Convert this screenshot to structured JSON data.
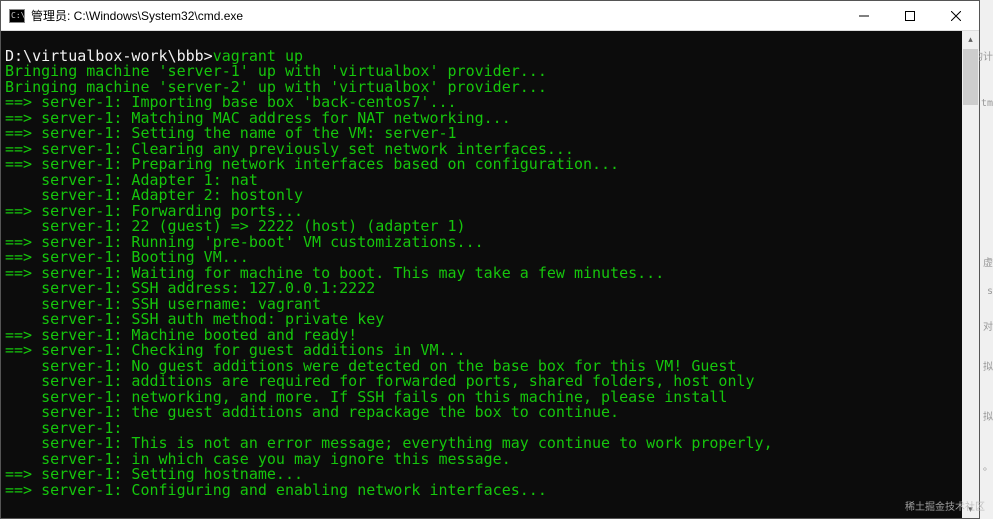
{
  "titlebar": {
    "icon_label": "C:\\",
    "title": "管理员: C:\\Windows\\System32\\cmd.exe"
  },
  "prompt": {
    "path": "D:\\virtualbox-work\\bbb>",
    "command": "vagrant up"
  },
  "lines": [
    "Bringing machine 'server-1' up with 'virtualbox' provider...",
    "Bringing machine 'server-2' up with 'virtualbox' provider...",
    "==> server-1: Importing base box 'back-centos7'...",
    "==> server-1: Matching MAC address for NAT networking...",
    "==> server-1: Setting the name of the VM: server-1",
    "==> server-1: Clearing any previously set network interfaces...",
    "==> server-1: Preparing network interfaces based on configuration...",
    "    server-1: Adapter 1: nat",
    "    server-1: Adapter 2: hostonly",
    "==> server-1: Forwarding ports...",
    "    server-1: 22 (guest) => 2222 (host) (adapter 1)",
    "==> server-1: Running 'pre-boot' VM customizations...",
    "==> server-1: Booting VM...",
    "==> server-1: Waiting for machine to boot. This may take a few minutes...",
    "    server-1: SSH address: 127.0.0.1:2222",
    "    server-1: SSH username: vagrant",
    "    server-1: SSH auth method: private key",
    "==> server-1: Machine booted and ready!",
    "==> server-1: Checking for guest additions in VM...",
    "    server-1: No guest additions were detected on the base box for this VM! Guest",
    "    server-1: additions are required for forwarded ports, shared folders, host only",
    "    server-1: networking, and more. If SSH fails on this machine, please install",
    "    server-1: the guest additions and repackage the box to continue.",
    "    server-1:",
    "    server-1: This is not an error message; everything may continue to work properly,",
    "    server-1: in which case you may ignore this message.",
    "==> server-1: Setting hostname...",
    "==> server-1: Configuring and enabling network interfaces..."
  ],
  "watermark": "稀土掘金技术社区",
  "bg": {
    "f1": "的计",
    "f2": "tm",
    "f3": "虚",
    "f4": "s",
    "f5": "对",
    "f6": "拟",
    "f7": "拟",
    "f8": "。"
  }
}
